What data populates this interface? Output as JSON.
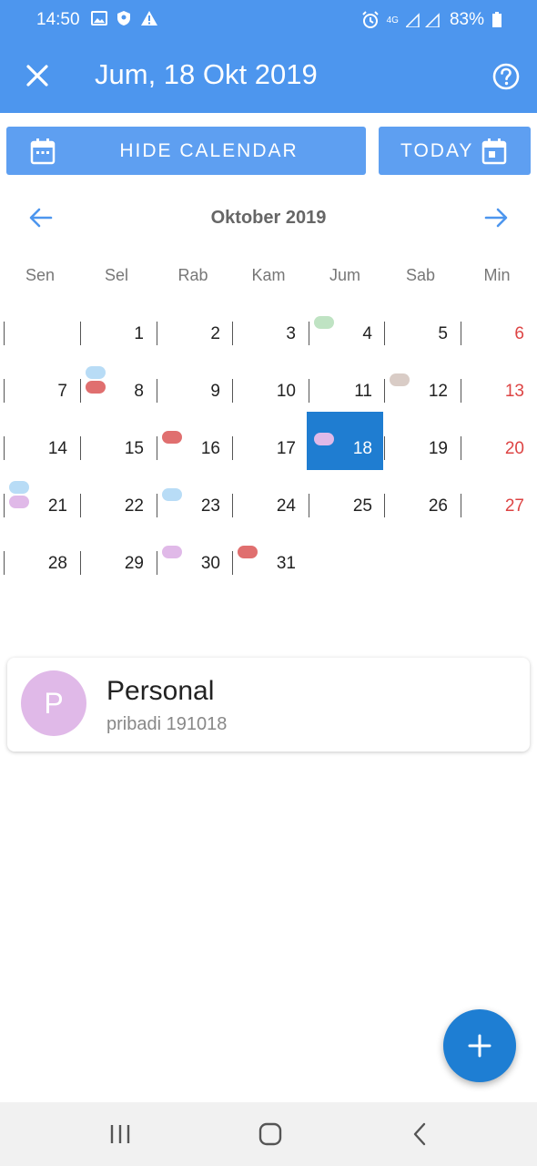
{
  "status_bar": {
    "time": "14:50",
    "battery": "83%",
    "network": "4G",
    "left_icons": [
      "gallery-icon",
      "shield-icon",
      "warning-icon"
    ],
    "right_icons": [
      "alarm-icon",
      "signal-icon",
      "battery-icon"
    ]
  },
  "app_bar": {
    "title": "Jum, 18 Okt 2019",
    "close_icon": "close-icon",
    "help_icon": "help-icon",
    "color": "#4d96ee"
  },
  "buttons": {
    "hide_calendar": "HIDE CALENDAR",
    "today": "TODAY"
  },
  "calendar": {
    "month_title": "Oktober 2019",
    "weekdays": [
      "Sen",
      "Sel",
      "Rab",
      "Kam",
      "Jum",
      "Sab",
      "Min"
    ],
    "selected_day": "18",
    "weeks": [
      [
        {
          "day": ""
        },
        {
          "day": "1"
        },
        {
          "day": "2"
        },
        {
          "day": "3"
        },
        {
          "day": "4",
          "events": [
            "#bfe3c3"
          ]
        },
        {
          "day": "5"
        },
        {
          "day": "6",
          "sunday": true
        }
      ],
      [
        {
          "day": "7"
        },
        {
          "day": "8",
          "events": [
            "#b8dcf6",
            "#e06f6f"
          ]
        },
        {
          "day": "9"
        },
        {
          "day": "10"
        },
        {
          "day": "11"
        },
        {
          "day": "12",
          "events": [
            "#d9ccc6"
          ]
        },
        {
          "day": "13",
          "sunday": true
        }
      ],
      [
        {
          "day": "14"
        },
        {
          "day": "15"
        },
        {
          "day": "16",
          "events": [
            "#e06f6f"
          ]
        },
        {
          "day": "17"
        },
        {
          "day": "18",
          "events": [
            "#e0b9e8"
          ],
          "selected": true
        },
        {
          "day": "19"
        },
        {
          "day": "20",
          "sunday": true
        }
      ],
      [
        {
          "day": "21",
          "events": [
            "#b8dcf6",
            "#e0b9e8"
          ]
        },
        {
          "day": "22"
        },
        {
          "day": "23",
          "events": [
            "#b8dcf6"
          ]
        },
        {
          "day": "24"
        },
        {
          "day": "25"
        },
        {
          "day": "26"
        },
        {
          "day": "27",
          "sunday": true
        }
      ],
      [
        {
          "day": "28"
        },
        {
          "day": "29"
        },
        {
          "day": "30",
          "events": [
            "#e0b9e8"
          ]
        },
        {
          "day": "31",
          "events": [
            "#e06f6f"
          ]
        }
      ]
    ]
  },
  "event_card": {
    "avatar_letter": "P",
    "title": "Personal",
    "subtitle": "pribadi 191018",
    "avatar_color": "#e0b9e8"
  },
  "fab": {
    "icon": "plus-icon"
  },
  "nav_bar": {
    "icons": [
      "recent-apps-icon",
      "home-icon",
      "back-icon"
    ]
  }
}
